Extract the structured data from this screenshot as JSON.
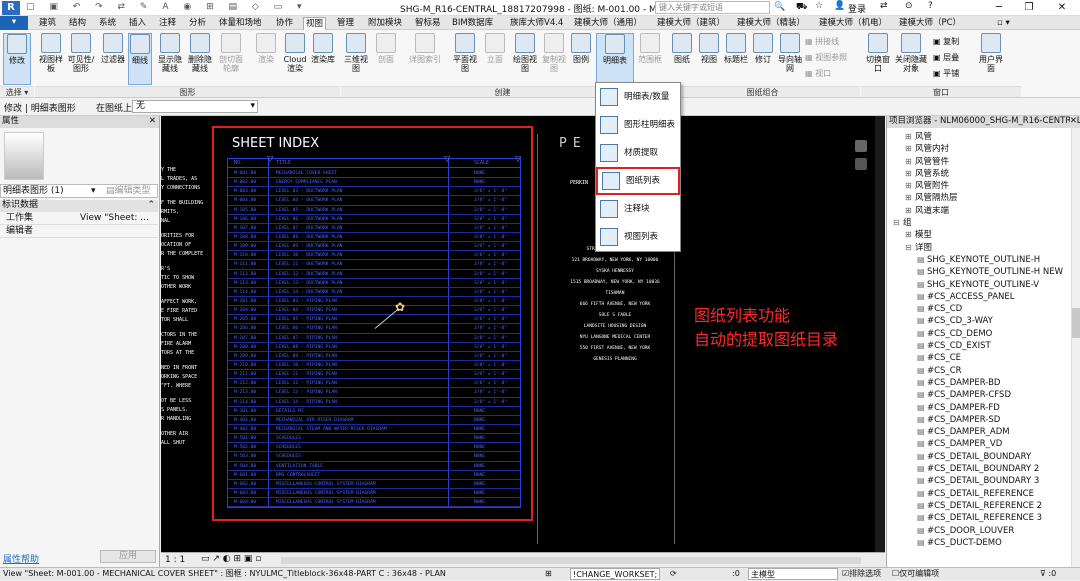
{
  "titlebar": {
    "title": "SHG-M_R16-CENTRAL_18817207998 - 图纸: M-001.00 - M...",
    "search_placeholder": "键入关键字或短语",
    "login": "登录",
    "help": "?"
  },
  "menu_tabs": [
    "建筑",
    "结构",
    "系统",
    "插入",
    "注释",
    "分析",
    "体量和场地",
    "协作",
    "视图",
    "管理",
    "附加模块",
    "智标易",
    "BIM数据库",
    "族库大师V4.4",
    "建模大师（通用）",
    "建模大师（建筑）",
    "建模大师（精装）",
    "建模大师（机电）",
    "建模大师（PC）"
  ],
  "ribbon": {
    "modify": "修改",
    "view_style": "视图样板",
    "vis_graphics": "可见性/图形",
    "filters": "过滤器",
    "thin_lines": "细线",
    "show_hidden": "显示隐藏线",
    "remove_hidden": "删除隐藏线",
    "cut_profile": "剖切面轮廓",
    "render": "渲染",
    "cloud_render": "Cloud渲染",
    "render_gallery": "渲染库",
    "view_3d": "三维视图",
    "section": "剖面",
    "callout": "详图索引",
    "plan": "平面视图",
    "elevation": "立面",
    "drafting": "绘图视图",
    "duplicate": "复制视图",
    "legend": "图例",
    "schedule": "明细表",
    "scope_box": "范围框",
    "sheet": "图纸",
    "view": "视图",
    "titleblock": "标题栏",
    "revisions": "修订",
    "guide_grid": "导向轴网",
    "matchline": "拼接线",
    "view_ref": "视图参照",
    "viewports": "视口",
    "switch_windows": "切换窗口",
    "close_hidden": "关闭隐藏对象",
    "replicate": "复制",
    "cascade": "层叠",
    "tile": "平铺",
    "user_interface": "用户界面",
    "groups": {
      "select": "选择",
      "graphics": "图形",
      "create": "创建",
      "sheet_comp": "图纸组合",
      "windows": "窗口"
    }
  },
  "dropdown": {
    "items": [
      "明细表/数量",
      "图形柱明细表",
      "材质提取",
      "图纸列表",
      "注释块",
      "视图列表"
    ]
  },
  "optbar": {
    "mode": "修改 | 明细表图形",
    "rotate_label": "在图纸上旋转:",
    "rotate_value": "无"
  },
  "properties": {
    "header": "属性",
    "type": "明细表图形 (1)",
    "edit_type": "编辑类型",
    "section": "标识数据",
    "rows": [
      {
        "key": "工作集",
        "value": "View \"Sheet: ..."
      },
      {
        "key": "编辑者",
        "value": ""
      }
    ],
    "help": "属性帮助",
    "apply": "应用"
  },
  "sheet": {
    "title": "SHEET INDEX",
    "col_no": "NO.",
    "col_title": "TITLE",
    "col_scale": "SCALE",
    "rows": [
      [
        "M-001.00",
        "MECHANICAL COVER SHEET",
        "NONE"
      ],
      [
        "M-002.00",
        "ENERGY COMPLIANCE PLAN",
        "NONE"
      ],
      [
        "M-003.00",
        "LEVEL 03 - DUCTWORK PLAN",
        "3/8\" = 1'-0\""
      ],
      [
        "M-004.00",
        "LEVEL 04 - DUCTWORK PLAN",
        "3/8\" = 1'-0\""
      ],
      [
        "M-105.00",
        "LEVEL 05 - DUCTWORK PLAN",
        "3/8\" = 1'-0\""
      ],
      [
        "M-106.00",
        "LEVEL 06 - DUCTWORK PLAN",
        "3/8\" = 1'-0\""
      ],
      [
        "M-107.00",
        "LEVEL 07 - DUCTWORK PLAN",
        "3/8\" = 1'-0\""
      ],
      [
        "M-108.00",
        "LEVEL 08 - DUCTWORK PLAN",
        "3/8\" = 1'-0\""
      ],
      [
        "M-109.00",
        "LEVEL 09 - DUCTWORK PLAN",
        "3/8\" = 1'-0\""
      ],
      [
        "M-110.00",
        "LEVEL 10 - DUCTWORK PLAN",
        "3/8\" = 1'-0\""
      ],
      [
        "M-111.00",
        "LEVEL 11 - DUCTWORK PLAN",
        "3/8\" = 1'-0\""
      ],
      [
        "M-112.00",
        "LEVEL 12 - DUCTWORK PLAN",
        "3/8\" = 1'-0\""
      ],
      [
        "M-113.00",
        "LEVEL 13 - DUCTWORK PLAN",
        "3/8\" = 1'-0\""
      ],
      [
        "M-114.00",
        "LEVEL 14 - DUCTWORK PLAN",
        "3/8\" = 1'-0\""
      ],
      [
        "M-201.00",
        "LEVEL 03 - PIPING PLAN",
        "3/8\" = 1'-0\""
      ],
      [
        "M-204.00",
        "LEVEL 04 - PIPING PLAN",
        "3/8\" = 1'-0\""
      ],
      [
        "M-205.00",
        "LEVEL 05 - PIPING PLAN",
        "3/8\" = 1'-0\""
      ],
      [
        "M-206.00",
        "LEVEL 06 - PIPING PLAN",
        "3/8\" = 1'-0\""
      ],
      [
        "M-207.00",
        "LEVEL 07 - PIPING PLAN",
        "3/8\" = 1'-0\""
      ],
      [
        "M-208.00",
        "LEVEL 08 - PIPING PLAN",
        "3/8\" = 1'-0\""
      ],
      [
        "M-209.00",
        "LEVEL 09 - PIPING PLAN",
        "3/8\" = 1'-0\""
      ],
      [
        "M-210.00",
        "LEVEL 10 - PIPING PLAN",
        "3/8\" = 1'-0\""
      ],
      [
        "M-211.00",
        "LEVEL 11 - PIPING PLAN",
        "3/8\" = 1'-0\""
      ],
      [
        "M-212.00",
        "LEVEL 12 - PIPING PLAN",
        "3/8\" = 1'-0\""
      ],
      [
        "M-213.00",
        "LEVEL 13 - PIPING PLAN",
        "3/8\" = 1'-0\""
      ],
      [
        "M-214.00",
        "LEVEL 14 - PIPING PLAN",
        "3/8\" = 1'-0\""
      ],
      [
        "M-301.00",
        "DETAILS M1",
        "NONE"
      ],
      [
        "M-401.00",
        "MECHANICAL AIR RISER DIAGRAM",
        "NONE"
      ],
      [
        "M-402.00",
        "MECHANICAL STEAM AND WATER RISER DIAGRAM",
        "NONE"
      ],
      [
        "M-501.00",
        "SCHEDULES",
        "NONE"
      ],
      [
        "M-502.00",
        "SCHEDULES",
        "NONE"
      ],
      [
        "M-503.00",
        "SCHEDULES",
        "NONE"
      ],
      [
        "M-504.00",
        "VENTILATION TABLE",
        "NONE"
      ],
      [
        "M-601.00",
        "BMS CONTROLSHEET",
        "NONE"
      ],
      [
        "M-602.00",
        "MISCELLANEOUS CONTROL SYSTEM DIAGRAM",
        "NONE"
      ],
      [
        "M-603.00",
        "MISCELLANEOUS CONTROL SYSTEM DIAGRAM",
        "NONE"
      ],
      [
        "M-604.00",
        "MISCELLANEOUS CONTROL SYSTEM DIAGRAM",
        "NONE"
      ]
    ],
    "left_notes": [
      "Y THE",
      "L TRADES, AS",
      "Y CONNECTIONS",
      "F THE BUILDING",
      "RMITS,",
      "NAL",
      "ORITIES FOR",
      "OCATION OF",
      "R THE COMPLETE",
      "R'S",
      "TIC TO SHOW",
      "OTHER WORK",
      "AFFECT WORK,",
      "E FIRE RATED",
      "TOR SHALL",
      "CTORS IN THE",
      "FIRE ALARM",
      "TORS AT THE",
      "NED IN FRONT",
      "ORKING SPACE",
      "\"FT. WHERE",
      "OT BE LESS",
      "S PANELS.",
      "R HANDLING",
      "OTHER AIR",
      "ALL SHUT"
    ],
    "right_title": "PE",
    "right_sub": "PERKIN",
    "right_lines": [
      "STRA FORD ENGINEERING",
      "121 BROADWAY, NEW YORK, NY 10006",
      "SYSKA HENNESSY",
      "1515 BROADWAY, NEW YORK, NY 10036",
      "TISHMAN",
      "666 FIFTH AVENUE, NEW YORK",
      "SOLE S FABLE",
      "LANDSITE HOUSING DESIGN",
      "NYU LANGONE MEDICAL CENTER",
      "550 FIRST AVENUE, NEW YORK",
      "GENESIS PLANNING"
    ],
    "annotation_line1": "图纸列表功能",
    "annotation_line2": "自动的提取图纸目录"
  },
  "browser": {
    "header": "项目浏览器 - NLM06000_SHG-M_R16-CENTRAL_...",
    "items": [
      {
        "indent": 1,
        "text": "风管",
        "expand": "+"
      },
      {
        "indent": 1,
        "text": "风管内衬",
        "expand": "+"
      },
      {
        "indent": 1,
        "text": "风管管件",
        "expand": "+"
      },
      {
        "indent": 1,
        "text": "风管系统",
        "expand": "+"
      },
      {
        "indent": 1,
        "text": "风管附件",
        "expand": "+"
      },
      {
        "indent": 1,
        "text": "风管隔热层",
        "expand": "+"
      },
      {
        "indent": 1,
        "text": "风道末端",
        "expand": "+"
      },
      {
        "indent": 0,
        "text": "组",
        "expand": "-"
      },
      {
        "indent": 1,
        "text": "模型",
        "expand": "+"
      },
      {
        "indent": 1,
        "text": "详图",
        "expand": "-"
      },
      {
        "indent": 2,
        "text": "SHG_KEYNOTE_OUTLINE-H",
        "expand": ""
      },
      {
        "indent": 2,
        "text": "SHG_KEYNOTE_OUTLINE-H NEW",
        "expand": ""
      },
      {
        "indent": 2,
        "text": "SHG_KEYNOTE_OUTLINE-V",
        "expand": ""
      },
      {
        "indent": 2,
        "text": "#CS_ACCESS_PANEL",
        "expand": ""
      },
      {
        "indent": 2,
        "text": "#CS_CD",
        "expand": ""
      },
      {
        "indent": 2,
        "text": "#CS_CD_3-WAY",
        "expand": ""
      },
      {
        "indent": 2,
        "text": "#CS_CD_DEMO",
        "expand": ""
      },
      {
        "indent": 2,
        "text": "#CS_CD_EXIST",
        "expand": ""
      },
      {
        "indent": 2,
        "text": "#CS_CE",
        "expand": ""
      },
      {
        "indent": 2,
        "text": "#CS_CR",
        "expand": ""
      },
      {
        "indent": 2,
        "text": "#CS_DAMPER-BD",
        "expand": ""
      },
      {
        "indent": 2,
        "text": "#CS_DAMPER-CFSD",
        "expand": ""
      },
      {
        "indent": 2,
        "text": "#CS_DAMPER-FD",
        "expand": ""
      },
      {
        "indent": 2,
        "text": "#CS_DAMPER-SD",
        "expand": ""
      },
      {
        "indent": 2,
        "text": "#CS_DAMPER_ADM",
        "expand": ""
      },
      {
        "indent": 2,
        "text": "#CS_DAMPER_VD",
        "expand": ""
      },
      {
        "indent": 2,
        "text": "#CS_DETAIL_BOUNDARY",
        "expand": ""
      },
      {
        "indent": 2,
        "text": "#CS_DETAIL_BOUNDARY 2",
        "expand": ""
      },
      {
        "indent": 2,
        "text": "#CS_DETAIL_BOUNDARY 3",
        "expand": ""
      },
      {
        "indent": 2,
        "text": "#CS_DETAIL_REFERENCE",
        "expand": ""
      },
      {
        "indent": 2,
        "text": "#CS_DETAIL_REFERENCE 2",
        "expand": ""
      },
      {
        "indent": 2,
        "text": "#CS_DETAIL_REFERENCE 3",
        "expand": ""
      },
      {
        "indent": 2,
        "text": "#CS_DOOR_LOUVER",
        "expand": ""
      },
      {
        "indent": 2,
        "text": "#CS_DUCT-DEMO",
        "expand": ""
      }
    ]
  },
  "viewbar": {
    "scale": "1 : 1"
  },
  "status": {
    "text": "View \"Sheet: M-001.00 - MECHANICAL COVER SHEET\" : 图框 : NYULMC_Titleblock-36x48-PART C : 36x48 - PLAN",
    "workset": "!CHANGE_WORKSET;",
    "model": "主模型",
    "exclude": "排除选项",
    "editable": "仅可编辑项",
    "zero": ":0"
  },
  "colors": {
    "accent": "#1e6fc4",
    "highlight_red": "#e02020",
    "sheet_blue": "#2a3fd6"
  }
}
